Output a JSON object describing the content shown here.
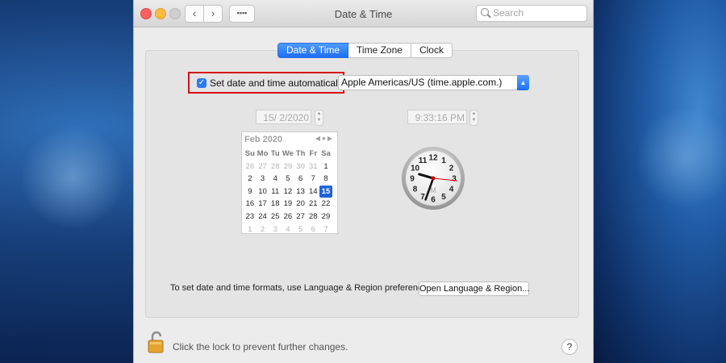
{
  "window": {
    "title": "Date & Time",
    "search_placeholder": "Search"
  },
  "tabs": [
    {
      "label": "Date & Time",
      "active": true
    },
    {
      "label": "Time Zone",
      "active": false
    },
    {
      "label": "Clock",
      "active": false
    }
  ],
  "auto_set": {
    "label": "Set date and time automatically:",
    "checked": true
  },
  "time_server": {
    "value": "Apple Americas/US (time.apple.com.)"
  },
  "date_field": {
    "value": "15/  2/2020"
  },
  "time_field": {
    "value": "9:33:16 PM"
  },
  "calendar": {
    "month_label": "Feb 2020",
    "weekdays": [
      "Su",
      "Mo",
      "Tu",
      "We",
      "Th",
      "Fr",
      "Sa"
    ],
    "days": [
      [
        "26",
        "27",
        "28",
        "29",
        "30",
        "31",
        "1"
      ],
      [
        "2",
        "3",
        "4",
        "5",
        "6",
        "7",
        "8"
      ],
      [
        "9",
        "10",
        "11",
        "12",
        "13",
        "14",
        "15"
      ],
      [
        "16",
        "17",
        "18",
        "19",
        "20",
        "21",
        "22"
      ],
      [
        "23",
        "24",
        "25",
        "26",
        "27",
        "28",
        "29"
      ],
      [
        "1",
        "2",
        "3",
        "4",
        "5",
        "6",
        "7"
      ]
    ],
    "selected_day": "15"
  },
  "clock": {
    "numbers": [
      "12",
      "1",
      "2",
      "3",
      "4",
      "5",
      "6",
      "7",
      "8",
      "9",
      "10",
      "11"
    ],
    "meridiem": "M",
    "hour": 9,
    "minute": 33,
    "second": 16
  },
  "formats": {
    "text": "To set date and time formats, use Language & Region preferences.",
    "button": "Open Language & Region..."
  },
  "lock": {
    "text": "Click the lock to prevent further changes."
  },
  "help": {
    "label": "?"
  },
  "colors": {
    "accent": "#2c7bf6",
    "highlight_box": "#d80d15",
    "second_hand": "#d40000"
  }
}
